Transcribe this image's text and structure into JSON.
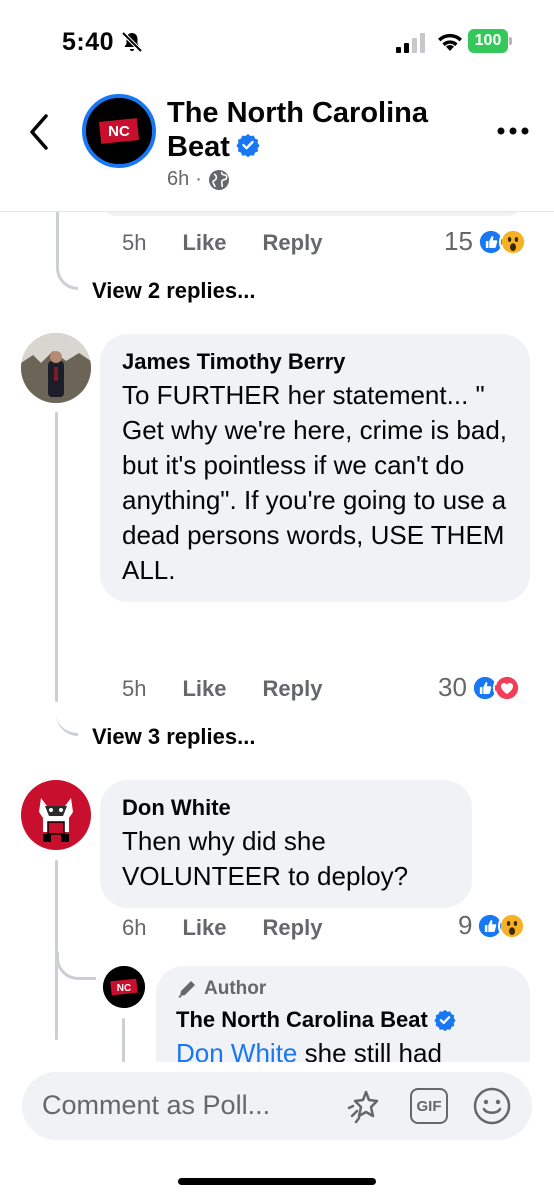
{
  "status": {
    "time": "5:40",
    "battery": "100"
  },
  "header": {
    "page_name": "The North Carolina Beat",
    "page_name_line1": "The North Carolina",
    "page_name_line2": "Beat",
    "timestamp": "6h",
    "dot": "·",
    "avatar_text": "NC"
  },
  "thread": {
    "prev_comment": {
      "time": "5h",
      "like": "Like",
      "reply": "Reply",
      "reaction_count": "15",
      "reactions": [
        "like",
        "wow"
      ]
    },
    "view_replies_1": "View 2 replies...",
    "comment1": {
      "author": "James Timothy Berry",
      "text": "To FURTHER her statement... \" Get why we're here, crime is bad, but it's pointless if we can't do anything\". If you're going to use a dead persons words, USE THEM ALL.",
      "time": "5h",
      "like": "Like",
      "reply": "Reply",
      "reaction_count": "30",
      "reactions": [
        "like",
        "love"
      ]
    },
    "view_replies_2": "View 3 replies...",
    "comment2": {
      "author": "Don White",
      "text": "Then why did she VOLUNTEER to deploy?",
      "time": "6h",
      "like": "Like",
      "reply": "Reply",
      "reaction_count": "9",
      "reactions": [
        "like",
        "wow"
      ]
    },
    "reply1": {
      "badge": "Author",
      "author": "The North Carolina Beat",
      "mention": "Don White",
      "text": " she still had"
    }
  },
  "composer": {
    "placeholder": "Comment as Poll...",
    "gif": "GIF"
  },
  "colors": {
    "accent": "#1877f2",
    "love": "#f33e58",
    "wow": "#f7b125",
    "battery": "#34c759"
  }
}
